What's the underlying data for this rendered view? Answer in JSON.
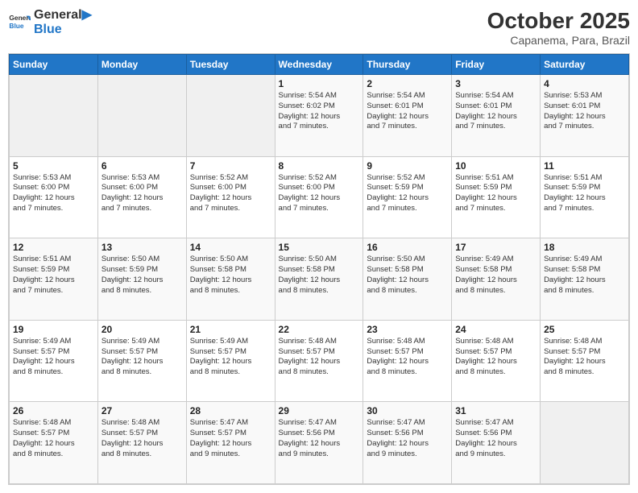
{
  "header": {
    "logo_line1": "General",
    "logo_line2": "Blue",
    "month": "October 2025",
    "location": "Capanema, Para, Brazil"
  },
  "days_of_week": [
    "Sunday",
    "Monday",
    "Tuesday",
    "Wednesday",
    "Thursday",
    "Friday",
    "Saturday"
  ],
  "weeks": [
    [
      {
        "day": "",
        "info": ""
      },
      {
        "day": "",
        "info": ""
      },
      {
        "day": "",
        "info": ""
      },
      {
        "day": "1",
        "info": "Sunrise: 5:54 AM\nSunset: 6:02 PM\nDaylight: 12 hours\nand 7 minutes."
      },
      {
        "day": "2",
        "info": "Sunrise: 5:54 AM\nSunset: 6:01 PM\nDaylight: 12 hours\nand 7 minutes."
      },
      {
        "day": "3",
        "info": "Sunrise: 5:54 AM\nSunset: 6:01 PM\nDaylight: 12 hours\nand 7 minutes."
      },
      {
        "day": "4",
        "info": "Sunrise: 5:53 AM\nSunset: 6:01 PM\nDaylight: 12 hours\nand 7 minutes."
      }
    ],
    [
      {
        "day": "5",
        "info": "Sunrise: 5:53 AM\nSunset: 6:00 PM\nDaylight: 12 hours\nand 7 minutes."
      },
      {
        "day": "6",
        "info": "Sunrise: 5:53 AM\nSunset: 6:00 PM\nDaylight: 12 hours\nand 7 minutes."
      },
      {
        "day": "7",
        "info": "Sunrise: 5:52 AM\nSunset: 6:00 PM\nDaylight: 12 hours\nand 7 minutes."
      },
      {
        "day": "8",
        "info": "Sunrise: 5:52 AM\nSunset: 6:00 PM\nDaylight: 12 hours\nand 7 minutes."
      },
      {
        "day": "9",
        "info": "Sunrise: 5:52 AM\nSunset: 5:59 PM\nDaylight: 12 hours\nand 7 minutes."
      },
      {
        "day": "10",
        "info": "Sunrise: 5:51 AM\nSunset: 5:59 PM\nDaylight: 12 hours\nand 7 minutes."
      },
      {
        "day": "11",
        "info": "Sunrise: 5:51 AM\nSunset: 5:59 PM\nDaylight: 12 hours\nand 7 minutes."
      }
    ],
    [
      {
        "day": "12",
        "info": "Sunrise: 5:51 AM\nSunset: 5:59 PM\nDaylight: 12 hours\nand 7 minutes."
      },
      {
        "day": "13",
        "info": "Sunrise: 5:50 AM\nSunset: 5:59 PM\nDaylight: 12 hours\nand 8 minutes."
      },
      {
        "day": "14",
        "info": "Sunrise: 5:50 AM\nSunset: 5:58 PM\nDaylight: 12 hours\nand 8 minutes."
      },
      {
        "day": "15",
        "info": "Sunrise: 5:50 AM\nSunset: 5:58 PM\nDaylight: 12 hours\nand 8 minutes."
      },
      {
        "day": "16",
        "info": "Sunrise: 5:50 AM\nSunset: 5:58 PM\nDaylight: 12 hours\nand 8 minutes."
      },
      {
        "day": "17",
        "info": "Sunrise: 5:49 AM\nSunset: 5:58 PM\nDaylight: 12 hours\nand 8 minutes."
      },
      {
        "day": "18",
        "info": "Sunrise: 5:49 AM\nSunset: 5:58 PM\nDaylight: 12 hours\nand 8 minutes."
      }
    ],
    [
      {
        "day": "19",
        "info": "Sunrise: 5:49 AM\nSunset: 5:57 PM\nDaylight: 12 hours\nand 8 minutes."
      },
      {
        "day": "20",
        "info": "Sunrise: 5:49 AM\nSunset: 5:57 PM\nDaylight: 12 hours\nand 8 minutes."
      },
      {
        "day": "21",
        "info": "Sunrise: 5:49 AM\nSunset: 5:57 PM\nDaylight: 12 hours\nand 8 minutes."
      },
      {
        "day": "22",
        "info": "Sunrise: 5:48 AM\nSunset: 5:57 PM\nDaylight: 12 hours\nand 8 minutes."
      },
      {
        "day": "23",
        "info": "Sunrise: 5:48 AM\nSunset: 5:57 PM\nDaylight: 12 hours\nand 8 minutes."
      },
      {
        "day": "24",
        "info": "Sunrise: 5:48 AM\nSunset: 5:57 PM\nDaylight: 12 hours\nand 8 minutes."
      },
      {
        "day": "25",
        "info": "Sunrise: 5:48 AM\nSunset: 5:57 PM\nDaylight: 12 hours\nand 8 minutes."
      }
    ],
    [
      {
        "day": "26",
        "info": "Sunrise: 5:48 AM\nSunset: 5:57 PM\nDaylight: 12 hours\nand 8 minutes."
      },
      {
        "day": "27",
        "info": "Sunrise: 5:48 AM\nSunset: 5:57 PM\nDaylight: 12 hours\nand 8 minutes."
      },
      {
        "day": "28",
        "info": "Sunrise: 5:47 AM\nSunset: 5:57 PM\nDaylight: 12 hours\nand 9 minutes."
      },
      {
        "day": "29",
        "info": "Sunrise: 5:47 AM\nSunset: 5:56 PM\nDaylight: 12 hours\nand 9 minutes."
      },
      {
        "day": "30",
        "info": "Sunrise: 5:47 AM\nSunset: 5:56 PM\nDaylight: 12 hours\nand 9 minutes."
      },
      {
        "day": "31",
        "info": "Sunrise: 5:47 AM\nSunset: 5:56 PM\nDaylight: 12 hours\nand 9 minutes."
      },
      {
        "day": "",
        "info": ""
      }
    ]
  ]
}
